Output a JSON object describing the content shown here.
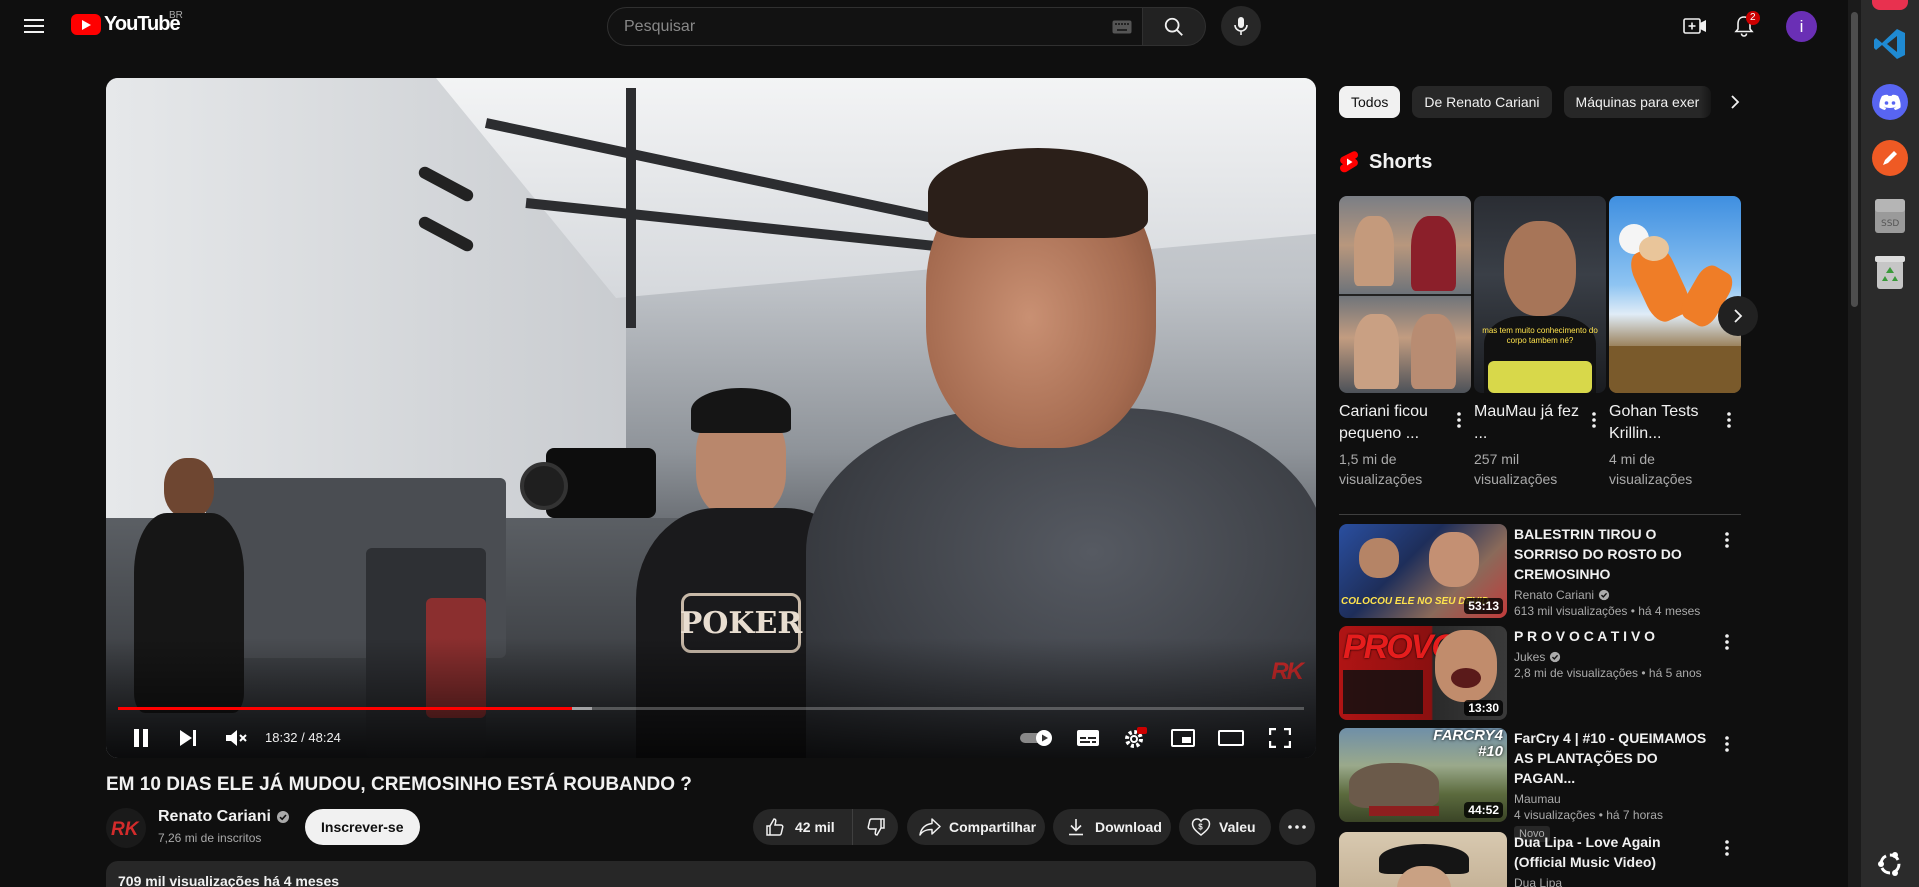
{
  "masthead": {
    "logo_text": "YouTube",
    "country_code": "BR",
    "search_placeholder": "Pesquisar",
    "notification_count": "2",
    "avatar_letter": "i"
  },
  "player": {
    "time_display": "18:32 / 48:24",
    "progress_played": 0.383,
    "progress_loaded": 0.4,
    "watermark": "RK",
    "poker_shirt_text": "POKER"
  },
  "video": {
    "title": "EM 10 DIAS ELE JÁ MUDOU, CREMOSINHO ESTÁ ROUBANDO ?",
    "channel_name": "Renato Cariani",
    "subscribers": "7,26 mi de inscritos",
    "subscribe_label": "Inscrever-se",
    "likes": "42 mil",
    "share_label": "Compartilhar",
    "download_label": "Download",
    "thanks_label": "Valeu",
    "description_summary": "709 mil visualizações  há 4 meses"
  },
  "chips": [
    {
      "label": "Todos",
      "active": true
    },
    {
      "label": "De Renato Cariani",
      "active": false
    },
    {
      "label": "Máquinas para exer",
      "active": false
    }
  ],
  "shorts": {
    "header": "Shorts",
    "items": [
      {
        "title": "Cariani ficou pequeno ...",
        "views": "1,5 mi de visualizações"
      },
      {
        "title": "MauMau já fez ...",
        "views": "257 mil visualizações"
      },
      {
        "title": "Gohan Tests Krillin...",
        "views": "4 mi de visualizações"
      }
    ]
  },
  "recommendations": [
    {
      "title": "BALESTRIN TIROU O SORRISO DO ROSTO DO CREMOSINHO",
      "channel": "Renato Cariani",
      "verified": true,
      "meta": "613 mil visualizações  • há 4 meses",
      "duration": "53:13",
      "badge": ""
    },
    {
      "title": "P R O V O C A T I V O",
      "channel": "Jukes",
      "verified": true,
      "meta": "2,8 mi de visualizações  • há 5 anos",
      "duration": "13:30",
      "badge": ""
    },
    {
      "title": "FarCry 4 | #10 - QUEIMAMOS AS PLANTAÇÕES DO PAGAN...",
      "channel": "Maumau",
      "verified": false,
      "meta": "4 visualizações  • há 7 horas",
      "duration": "44:52",
      "badge": "Novo"
    },
    {
      "title": "Dua Lipa - Love Again (Official Music Video)",
      "channel": "Dua Lipa",
      "verified": false,
      "meta": "",
      "duration": "",
      "badge": ""
    }
  ],
  "thumb_text": {
    "rec1_caption": "COLOCOU ELE NO SEU DEVID",
    "rec2_caption": "PROVOC",
    "rec3_caption": "FARCRY4 #10",
    "short2_caption": "mas tem muito conhecimento do corpo tambem né?"
  },
  "dock": {
    "ssd_label": "SSD"
  },
  "colors": {
    "accent_red": "#ff0000",
    "background": "#0f0f0f",
    "surface": "#272727"
  }
}
